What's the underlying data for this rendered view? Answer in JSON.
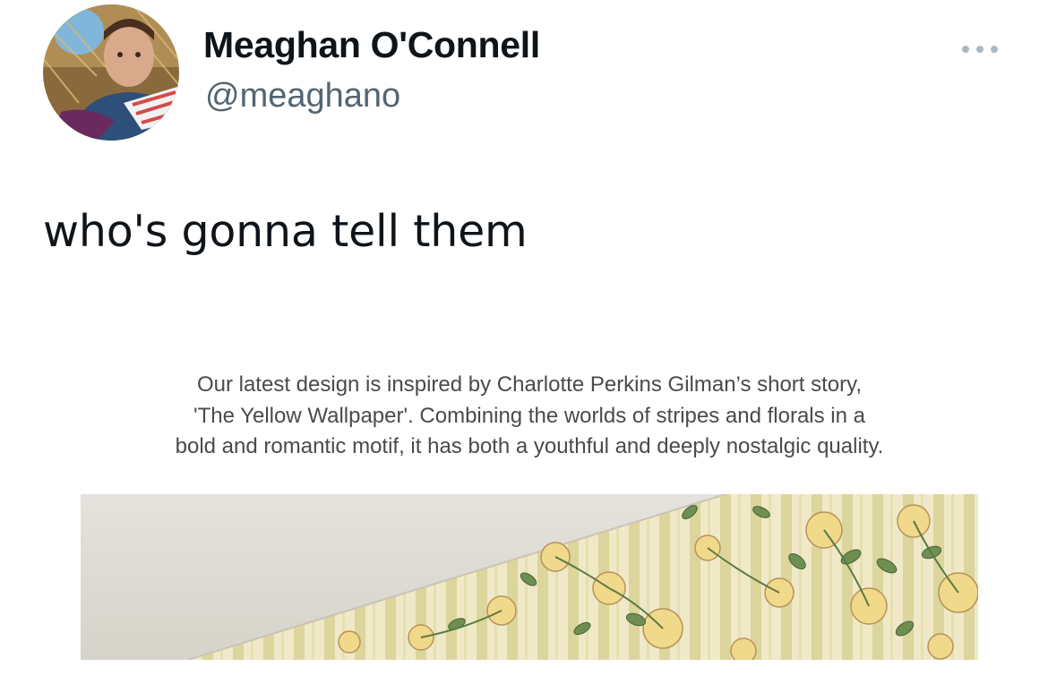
{
  "tweet": {
    "author": {
      "display_name": "Meaghan O'Connell",
      "handle": "@meaghano",
      "avatar_icon": "profile-photo"
    },
    "more_icon": "more-horizontal-icon",
    "text": "who's gonna tell them",
    "embedded_image": {
      "caption_lines": [
        "Our latest design is inspired by Charlotte Perkins Gilman’s short story,",
        "'The Yellow Wallpaper'. Combining the worlds of stripes and florals in a",
        "bold and romantic motif, it has both a youthful and deeply nostalgic quality."
      ],
      "photo": "yellow-floral-striped-wallpaper"
    }
  },
  "colors": {
    "text_primary": "#0f1419",
    "text_secondary": "#536471",
    "caption_text": "#4a4a4a",
    "dots": "#aab8c2",
    "wallpaper_base": "#efe9c8",
    "wallpaper_stripe": "#dcd59c",
    "rose_yellow": "#f0d98a",
    "leaf_green": "#6f8f52"
  }
}
